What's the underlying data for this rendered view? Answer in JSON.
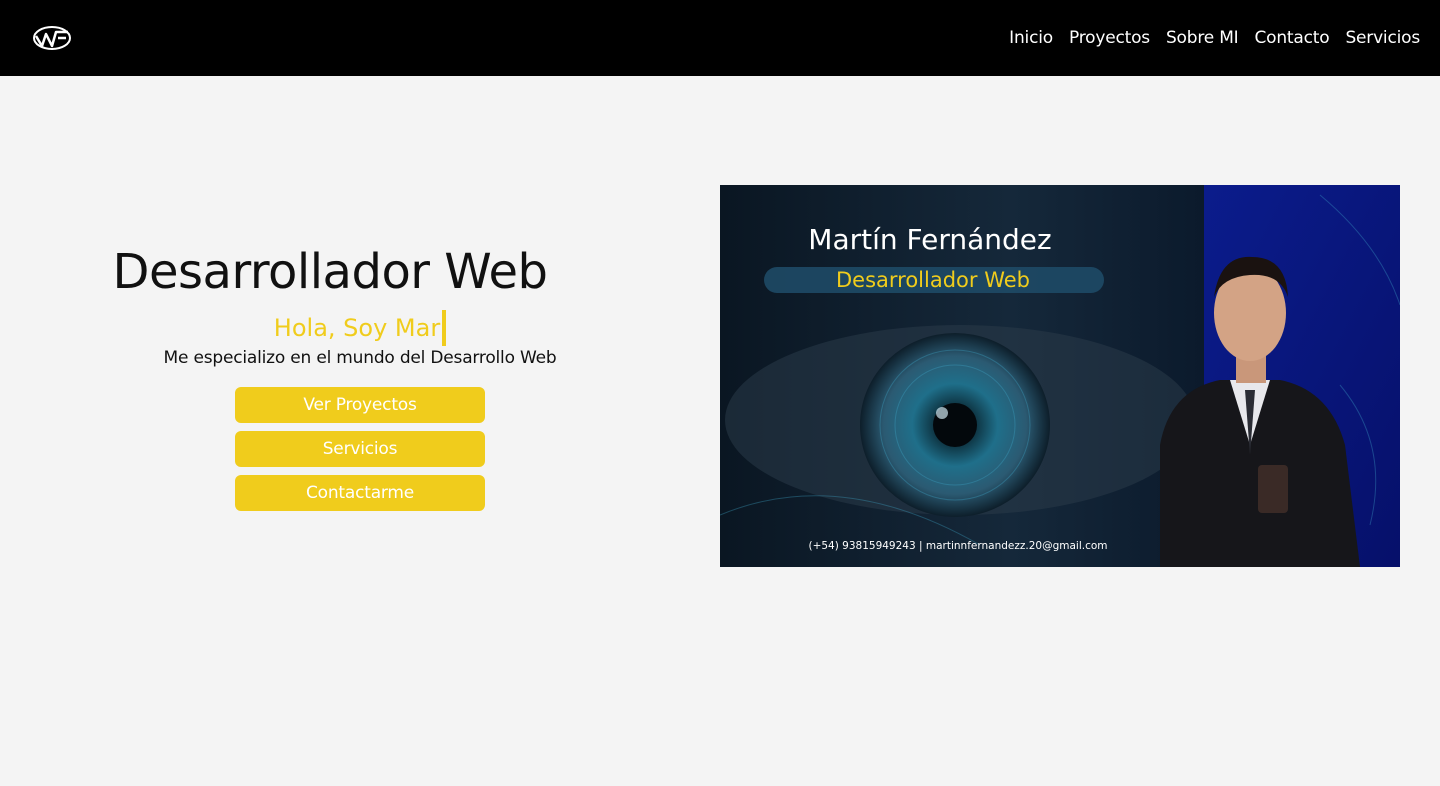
{
  "nav": {
    "links": [
      "Inicio",
      "Proyectos",
      "Sobre MI",
      "Contacto",
      "Servicios"
    ]
  },
  "hero": {
    "title": "Desarrollador Web",
    "greeting": "Hola, Soy Mar",
    "subtitle": "Me especializo en el mundo del Desarrollo Web",
    "buttons": [
      "Ver Proyectos",
      "Servicios",
      "Contactarme"
    ]
  },
  "banner": {
    "name": "Martín Fernández",
    "role": "Desarrollador Web",
    "contact": "(+54) 93815949243  | martinnfernandezz.20@gmail.com"
  },
  "colors": {
    "accent": "#f0cc1c",
    "navbar": "#000000",
    "background": "#f4f4f4"
  }
}
